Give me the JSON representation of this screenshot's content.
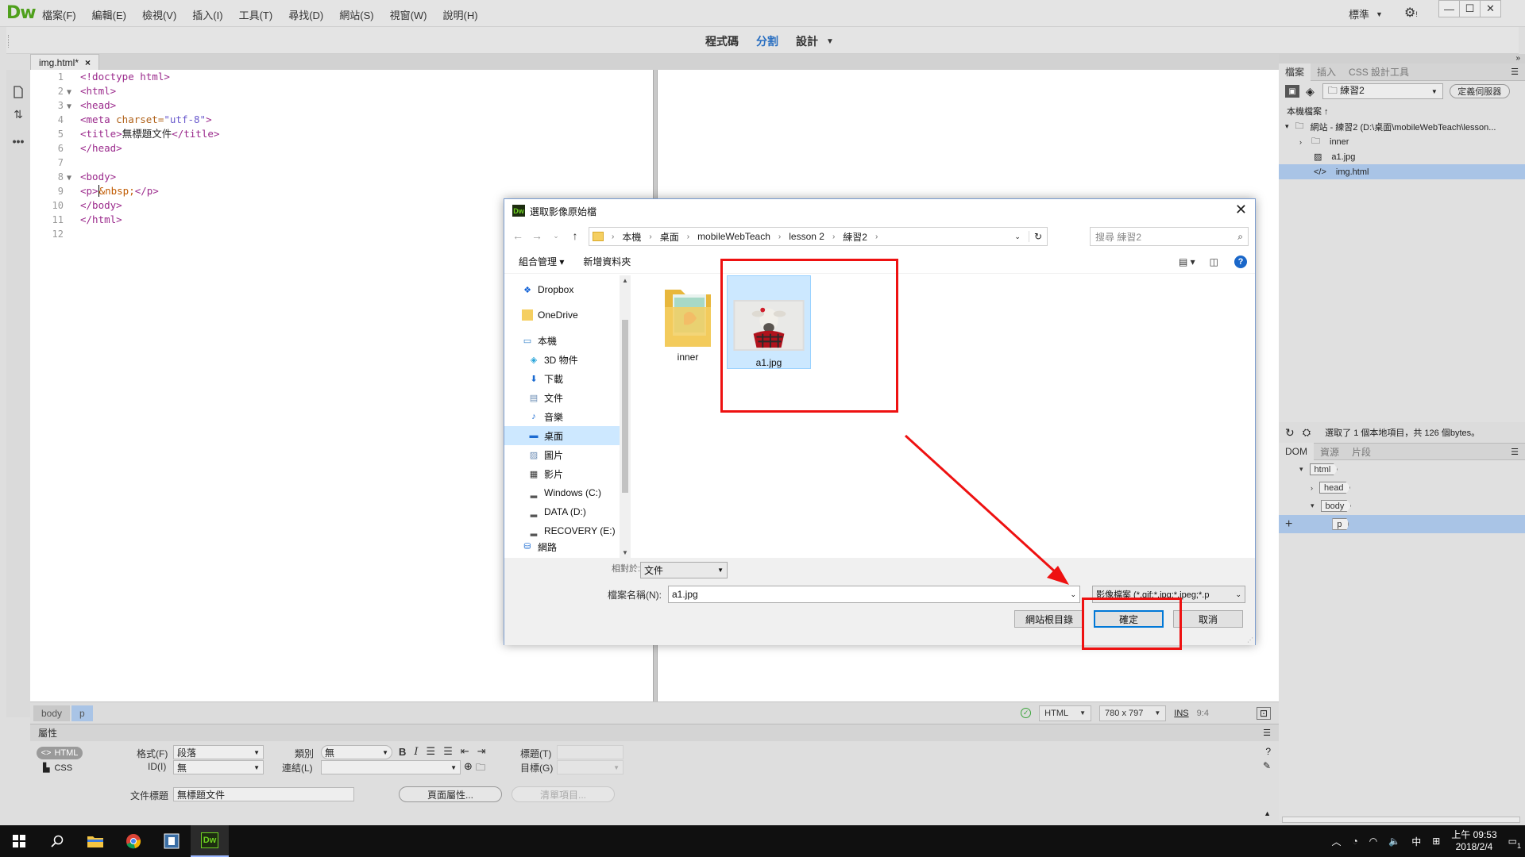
{
  "app": {
    "logo": "Dw",
    "menus": [
      "檔案(F)",
      "編輯(E)",
      "檢視(V)",
      "插入(I)",
      "工具(T)",
      "尋找(D)",
      "網站(S)",
      "視窗(W)",
      "說明(H)"
    ],
    "layout_select": "標準",
    "window_controls": [
      "—",
      "☐",
      "✕"
    ]
  },
  "view_tabs": {
    "code": "程式碼",
    "split": "分割",
    "design": "設計"
  },
  "document": {
    "tab_label": "img.html*",
    "tab_close": "×",
    "line_numbers": [
      "1",
      "2",
      "3",
      "4",
      "5",
      "6",
      "7",
      "8",
      "9",
      "10",
      "11",
      "12"
    ],
    "folds": [
      "",
      "▼",
      "▼",
      "",
      "",
      "",
      "",
      "▼",
      "",
      "",
      "",
      ""
    ]
  },
  "code": {
    "l1": "<!doctype html>",
    "l2": "<html>",
    "l3": "<head>",
    "l4_tag": "<meta ",
    "l4_attr": "charset=",
    "l4_val": "\"utf-8\"",
    "l4_end": ">",
    "l5_open": "<title>",
    "l5_text": "無標題文件",
    "l5_close": "</title>",
    "l6": "</head>",
    "l8": "<body>",
    "l9_open": "<p>",
    "l9_ent": "&nbsp;",
    "l9_close": "</p>",
    "l10": "</body>",
    "l11": "</html>"
  },
  "statusbar": {
    "crumbs": [
      "body",
      "p"
    ],
    "language": "HTML",
    "dimensions": "780 x 797",
    "ins": "INS",
    "position": "9:4"
  },
  "properties": {
    "header": "屬性",
    "html_toggle": "HTML",
    "css_toggle": "CSS",
    "format_label": "格式(F)",
    "format_value": "段落",
    "class_label": "類別",
    "class_value": "無",
    "id_label": "ID(I)",
    "id_value": "無",
    "link_label": "連結(L)",
    "title_label": "標題(T)",
    "target_label": "目標(G)",
    "doc_title_label": "文件標題",
    "doc_title_value": "無標題文件",
    "page_props_button": "頁面屬性...",
    "list_items_button": "清單項目..."
  },
  "files_panel": {
    "tabs": [
      "檔案",
      "插入",
      "CSS 設計工具"
    ],
    "site_select": "練習2",
    "define_server_button": "定義伺服器",
    "local_files_label": "本機檔案 ↑",
    "tree": [
      {
        "label": "網站 - 練習2 (D:\\桌面\\mobileWebTeach\\lesson...",
        "icon": "folder-icon",
        "depth": 0
      },
      {
        "label": "inner",
        "icon": "folder-icon",
        "depth": 1
      },
      {
        "label": "a1.jpg",
        "icon": "image-icon",
        "depth": 1
      },
      {
        "label": "img.html",
        "icon": "html-icon",
        "depth": 1,
        "selected": true
      }
    ],
    "status": "選取了 1 個本地項目，共 126 個bytes。"
  },
  "dom_panel": {
    "tabs": [
      "DOM",
      "資源",
      "片段"
    ],
    "nodes": [
      "html",
      "head",
      "body",
      "p"
    ]
  },
  "dialog": {
    "title": "選取影像原始檔",
    "breadcrumb": [
      "本機",
      "桌面",
      "mobileWebTeach",
      "lesson 2",
      "練習2"
    ],
    "search_placeholder": "搜尋 練習2",
    "organize": "組合管理 ▾",
    "new_folder": "新增資料夾",
    "nav_items": [
      {
        "label": "Dropbox",
        "icon": "dropbox-icon"
      },
      {
        "label": "OneDrive",
        "icon": "onedrive-icon"
      },
      {
        "label": "本機",
        "icon": "computer-icon"
      },
      {
        "label": "3D 物件",
        "icon": "cube-icon"
      },
      {
        "label": "下載",
        "icon": "download-icon"
      },
      {
        "label": "文件",
        "icon": "document-icon"
      },
      {
        "label": "音樂",
        "icon": "music-icon"
      },
      {
        "label": "桌面",
        "icon": "desktop-icon",
        "selected": true
      },
      {
        "label": "圖片",
        "icon": "picture-icon"
      },
      {
        "label": "影片",
        "icon": "video-icon"
      },
      {
        "label": "Windows (C:)",
        "icon": "drive-icon"
      },
      {
        "label": "DATA (D:)",
        "icon": "drive-icon"
      },
      {
        "label": "RECOVERY (E:)",
        "icon": "drive-icon"
      },
      {
        "label": "網路",
        "icon": "network-icon"
      }
    ],
    "files": [
      {
        "name": "inner",
        "type": "folder"
      },
      {
        "name": "a1.jpg",
        "type": "image",
        "selected": true
      }
    ],
    "relative_label": "相對於:",
    "relative_value": "文件",
    "filename_label": "檔案名稱(N):",
    "filename_value": "a1.jpg",
    "filetype_value": "影像檔案 (*.gif;*.jpg;*.jpeg;*.p",
    "site_root_button": "網站根目錄",
    "ok_button": "確定",
    "cancel_button": "取消"
  },
  "taskbar": {
    "ime": "中",
    "time": "上午 09:53",
    "date": "2018/2/4",
    "notifications": "1"
  },
  "annotation_color": "#ee1111"
}
